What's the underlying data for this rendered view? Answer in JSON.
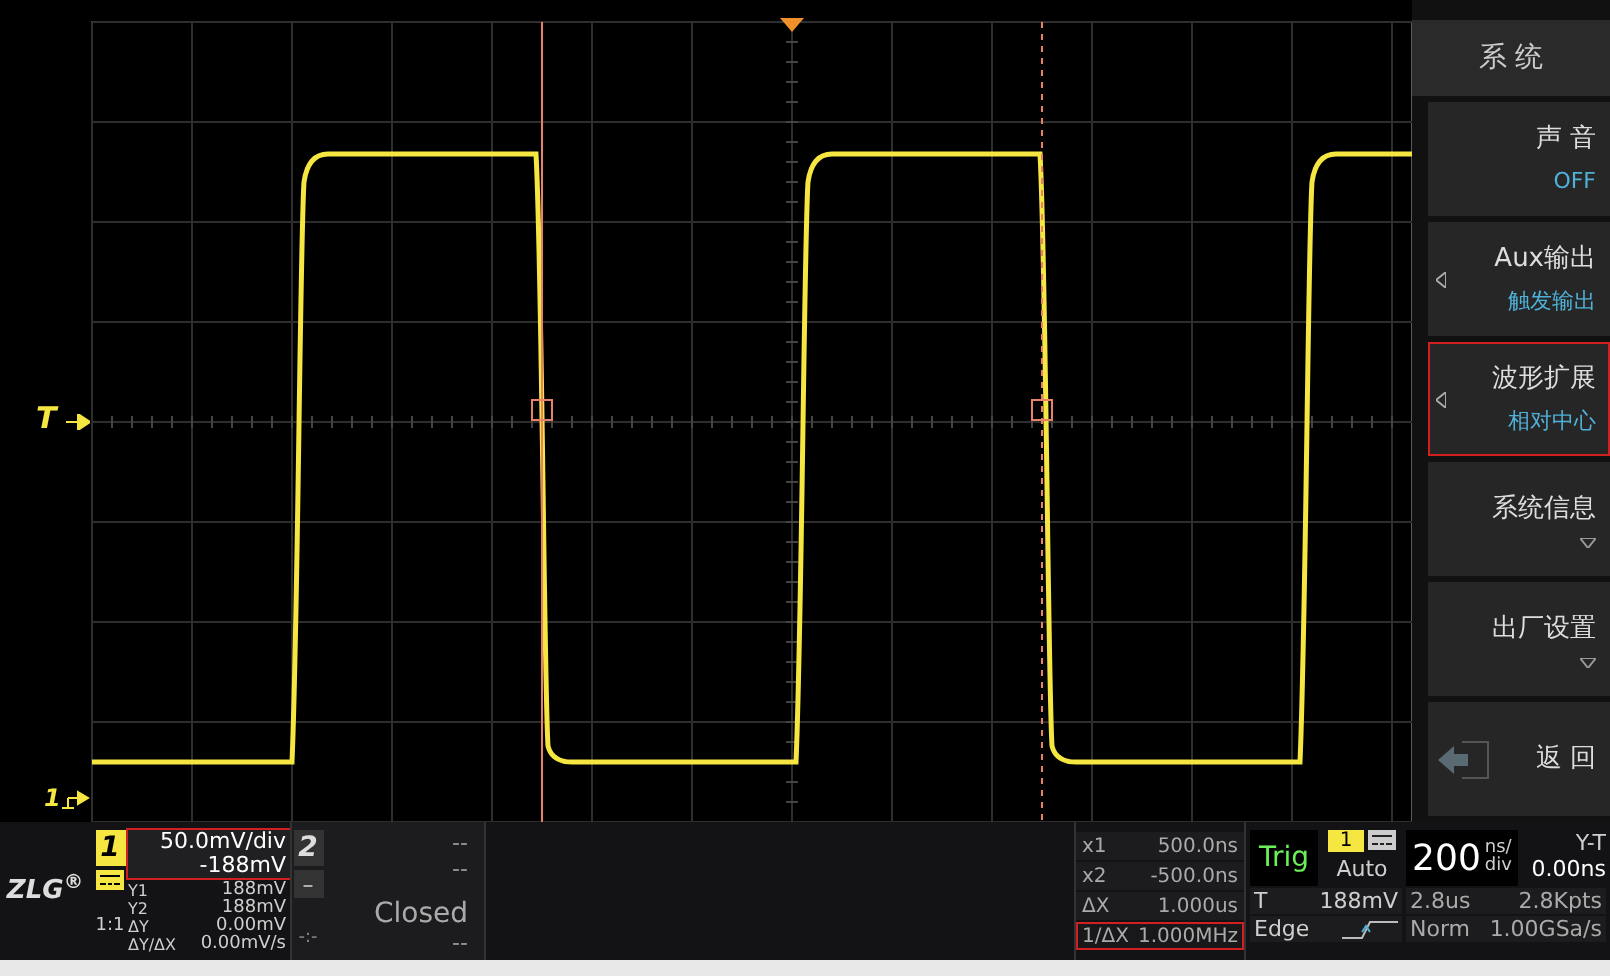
{
  "screen": {
    "trigger_marker": "T",
    "channel_marker": "1"
  },
  "menu": {
    "title": "系 统",
    "items": [
      {
        "label": "声 音",
        "value": "OFF",
        "kind": "value",
        "highlighted": false
      },
      {
        "label": "Aux输出",
        "value": "触发输出",
        "kind": "submenu",
        "highlighted": false
      },
      {
        "label": "波形扩展",
        "value": "相对中心",
        "kind": "submenu",
        "highlighted": true
      },
      {
        "label": "系统信息",
        "kind": "dropdown",
        "highlighted": false
      },
      {
        "label": "出厂设置",
        "kind": "dropdown",
        "highlighted": false
      },
      {
        "label": "返 回",
        "kind": "back",
        "highlighted": false
      }
    ]
  },
  "logo": "ZLG$^{®}$",
  "channel1": {
    "number": "1",
    "scale": "50.0mV/div",
    "offset": "-188mV",
    "highlighted": true,
    "probe": "1:1",
    "readings": [
      {
        "label": "Y1",
        "value": "188mV"
      },
      {
        "label": "Y2",
        "value": "188mV"
      },
      {
        "label": "ΔY",
        "value": "0.00mV"
      },
      {
        "label": "ΔY/ΔX",
        "value": "0.00mV/s"
      }
    ]
  },
  "channel2": {
    "number": "2",
    "scale": "--",
    "offset": "--",
    "button": "–",
    "status": "Closed",
    "probe": "-:-",
    "extra": "--"
  },
  "cursors": [
    {
      "label": "x1",
      "value": "500.0ns",
      "highlighted": false
    },
    {
      "label": "x2",
      "value": "-500.0ns",
      "highlighted": false
    },
    {
      "label": "ΔX",
      "value": "1.000us",
      "highlighted": false
    },
    {
      "label": "1/ΔX",
      "value": "1.000MHz",
      "highlighted": true
    }
  ],
  "trigger": {
    "status": "Trig",
    "source": "1",
    "mode": "Auto",
    "level_label": "T",
    "level_value": "188mV",
    "type": "Edge"
  },
  "timebase": {
    "scale": "200",
    "unit_top": "ns/",
    "unit_bottom": "div",
    "mode": "Y-T",
    "offset": "0.00ns",
    "window": "2.8us",
    "points": "2.8Kpts",
    "acquisition": "Norm",
    "sample_rate": "1.00GSa/s"
  }
}
